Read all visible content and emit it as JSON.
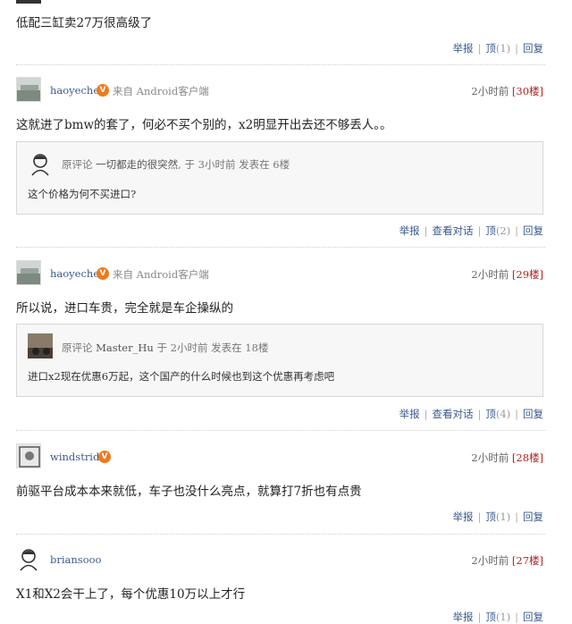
{
  "first_comment": {
    "text": "低配三缸卖27万很高级了",
    "actions": {
      "report": "举报",
      "up": "顶",
      "up_count": "(1)",
      "reply": "回复"
    }
  },
  "comments": [
    {
      "user": "haoyechen",
      "badge": "V",
      "source": "来自 Android客户端",
      "time": "2小时前",
      "floor": "[30楼]",
      "text": "这就进了bmw的套了，何必不买个别的，x2明显开出去还不够丢人。。",
      "quote": {
        "label": "原评论",
        "user": "一切都走的很突然",
        "meta": "于 3小时前 发表在 6楼",
        "text": "这个价格为何不买进口?"
      },
      "actions": {
        "report": "举报",
        "view": "查看对话",
        "up": "顶",
        "up_count": "(2)",
        "reply": "回复"
      }
    },
    {
      "user": "haoyechen",
      "badge": "V",
      "source": "来自 Android客户端",
      "time": "2小时前",
      "floor": "[29楼]",
      "text": "所以说，进口车贵，完全就是车企操纵的",
      "quote": {
        "label": "原评论",
        "user": "Master_Hu",
        "meta": "于 2小时前 发表在 18楼",
        "text": "进口x2现在优惠6万起，这个国产的什么时候也到这个优惠再考虑吧"
      },
      "actions": {
        "report": "举报",
        "view": "查看对话",
        "up": "顶",
        "up_count": "(4)",
        "reply": "回复"
      }
    },
    {
      "user": "windstrider",
      "badge": "V",
      "time": "2小时前",
      "floor": "[28楼]",
      "text": "前驱平台成本本来就低，车子也没什么亮点，就算打7折也有点贵",
      "actions": {
        "report": "举报",
        "up": "顶",
        "up_count": "(1)",
        "reply": "回复"
      }
    },
    {
      "user": "briansooo",
      "time": "2小时前",
      "floor": "[27楼]",
      "text": "X1和X2会干上了，每个优惠10万以上才行",
      "actions": {
        "report": "举报",
        "up": "顶",
        "up_count": "(1)",
        "reply": "回复"
      }
    }
  ]
}
